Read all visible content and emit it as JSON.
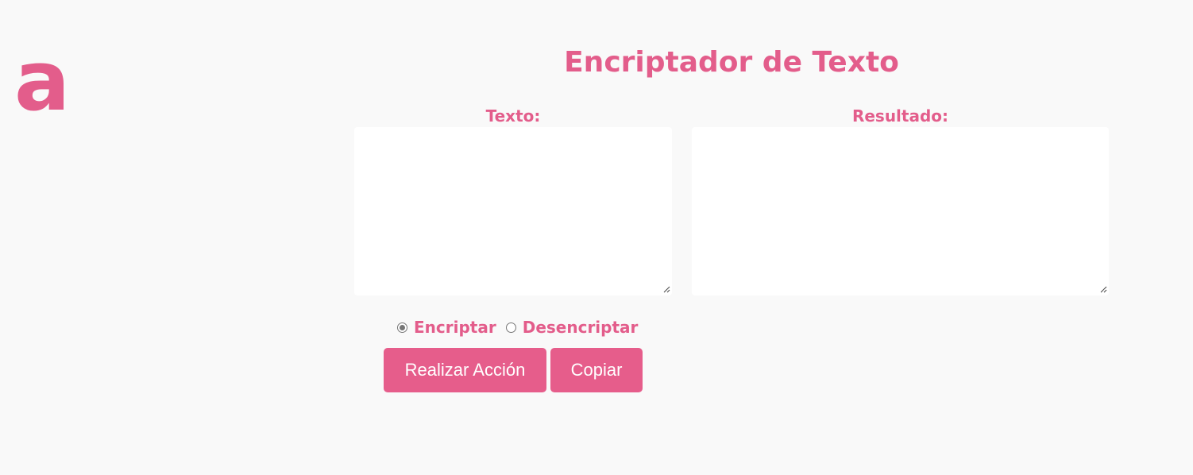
{
  "logo": {
    "letter": "a",
    "color": "#e35d8b"
  },
  "header": {
    "title": "Encriptador de Texto"
  },
  "input_panel": {
    "label": "Texto:",
    "value": "",
    "placeholder": ""
  },
  "result_panel": {
    "label": "Resultado:",
    "value": "",
    "placeholder": ""
  },
  "mode": {
    "options": [
      {
        "label": "Encriptar",
        "checked": true
      },
      {
        "label": "Desencriptar",
        "checked": false
      }
    ]
  },
  "actions": {
    "perform_label": "Realizar Acción",
    "copy_label": "Copiar"
  },
  "colors": {
    "accent": "#e35d8b",
    "button": "#e65d8b",
    "background": "#f9f9f9",
    "panel": "#ffffff"
  }
}
